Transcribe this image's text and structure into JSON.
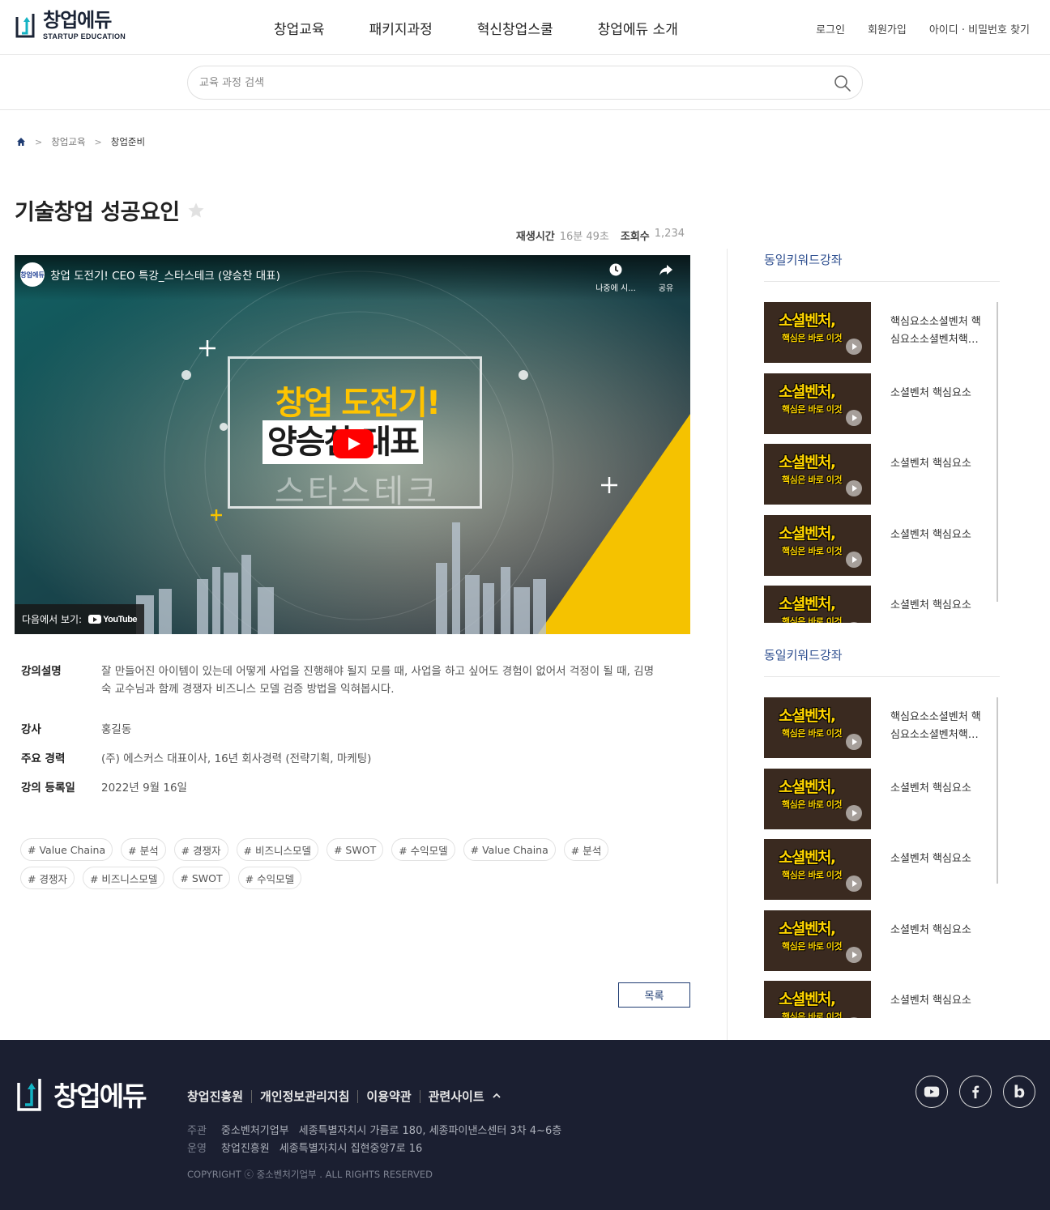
{
  "header": {
    "logo_name": "창업에듀",
    "logo_sub": "STARTUP EDUCATION",
    "nav": [
      "창업교육",
      "패키지과정",
      "혁신창업스쿨",
      "창업에듀 소개"
    ],
    "util": [
      "로그인",
      "회원가입",
      "아이디 · 비밀번호 찾기"
    ]
  },
  "search": {
    "placeholder": "교육 과정 검색"
  },
  "breadcrumb": {
    "items": [
      "창업교육",
      "창업준비"
    ]
  },
  "lecture": {
    "title": "기술창업 성공요인",
    "play_time_label": "재생시간",
    "play_time": "16분 49초",
    "views_label": "조회수",
    "views": "1,234"
  },
  "video": {
    "channel_badge": "창업에듀",
    "title": "창업 도전기! CEO 특강_스타스테크 (양승찬 대표)",
    "watch_later": "나중에 시...",
    "share": "공유",
    "line1": "창업 도전기!",
    "line2": "양승찬 대표",
    "line3": "스타스테크",
    "watch_on": "다음에서 보기:",
    "youtube": "YouTube"
  },
  "info": {
    "desc_label": "강의설명",
    "desc": "잘 만들어진 아이템이 있는데 어떻게 사업을 진행해야 될지 모를 때, 사업을 하고 싶어도 경험이 없어서 걱정이 될 때, 김명숙 교수님과 함께 경쟁자 비즈니스 모델 검증 방법을 익혀봅시다.",
    "teacher_label": "강사",
    "teacher": "홍길동",
    "career_label": "주요 경력",
    "career": "(주) 에스커스 대표이사, 16년 회사경력 (전략기획, 마케팅)",
    "date_label": "강의 등록일",
    "date": "2022년 9월 16일"
  },
  "tags": [
    "# Value Chaina",
    "# 분석",
    "# 경쟁자",
    "# 비즈니스모델",
    "# SWOT",
    "# 수익모델",
    "# Value Chaina",
    "# 분석",
    "# 경쟁자",
    "# 비즈니스모델",
    "# SWOT",
    "# 수익모델"
  ],
  "list_button": "목록",
  "sidebar": [
    {
      "title": "동일키워드강좌",
      "items": [
        {
          "title": "핵심요소소셜벤처 핵심요소소셜벤처핵심요소"
        },
        {
          "title": "소셜벤처 핵심요소"
        },
        {
          "title": "소셜벤처 핵심요소"
        },
        {
          "title": "소셜벤처 핵심요소"
        },
        {
          "title": "소셜벤처 핵심요소"
        }
      ]
    },
    {
      "title": "동일키워드강좌",
      "items": [
        {
          "title": "핵심요소소셜벤처 핵심요소소셜벤처핵심요소"
        },
        {
          "title": "소셜벤처 핵심요소"
        },
        {
          "title": "소셜벤처 핵심요소"
        },
        {
          "title": "소셜벤처 핵심요소"
        },
        {
          "title": "소셜벤처 핵심요소"
        }
      ]
    }
  ],
  "thumb": {
    "line1": "소셜벤처,",
    "line2": "핵심은 바로 이것"
  },
  "footer": {
    "logo_name": "창업에듀",
    "links": [
      "창업진흥원",
      "개인정보관리지침",
      "이용약관",
      "관련사이트"
    ],
    "host_label": "주관",
    "host_org": "중소벤처기업부",
    "host_addr": "세종특별자치시 가름로 180, 세종파이낸스센터 3차 4~6층",
    "op_label": "운영",
    "op_org": "창업진흥원",
    "op_addr": "세종특별자치시 집현중앙7로 16",
    "copyright": "COPYRIGHT ⓒ 중소벤처기업부 . ALL RIGHTS RESERVED",
    "sns": [
      "youtube-icon",
      "facebook-icon",
      "blog-icon"
    ],
    "sns_b": "b"
  },
  "colors": {
    "accent": "#2d4e8f",
    "footer_bg": "#1b1f31",
    "logo_teal": "#14b3c4"
  }
}
